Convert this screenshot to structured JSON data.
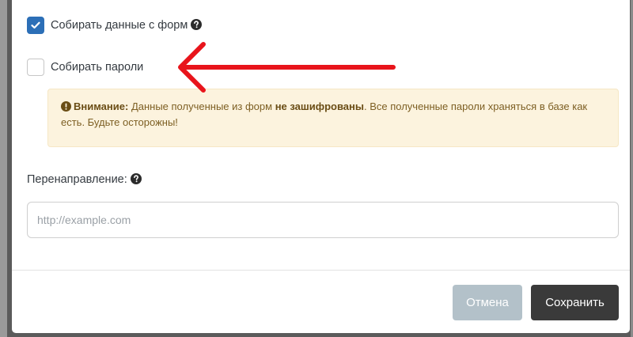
{
  "form": {
    "capture_forms": {
      "label": "Собирать данные с форм",
      "checked": true,
      "help_icon": "question-circle-icon"
    },
    "capture_passwords": {
      "label": "Собирать пароли",
      "checked": false
    },
    "warning": {
      "icon": "exclamation-circle-icon",
      "title": "Внимание:",
      "text_1": "Данные полученные из форм",
      "emphasis": "не зашифрованы",
      "text_2": ". Все полученные пароли храняться в базе как есть. Будьте осторожны!"
    },
    "redirect": {
      "label": "Перенаправление:",
      "help_icon": "question-circle-icon",
      "value": "",
      "placeholder": "http://example.com"
    }
  },
  "footer": {
    "cancel_label": "Отмена",
    "save_label": "Сохранить"
  },
  "annotation": {
    "icon": "red-arrow-icon",
    "color": "#e8141b"
  },
  "colors": {
    "checkbox_checked": "#2c6fb7",
    "alert_bg": "#fcf3de",
    "alert_text": "#7d5f23",
    "cancel_bg": "#b3c1c9",
    "save_bg": "#3a3a3a"
  }
}
